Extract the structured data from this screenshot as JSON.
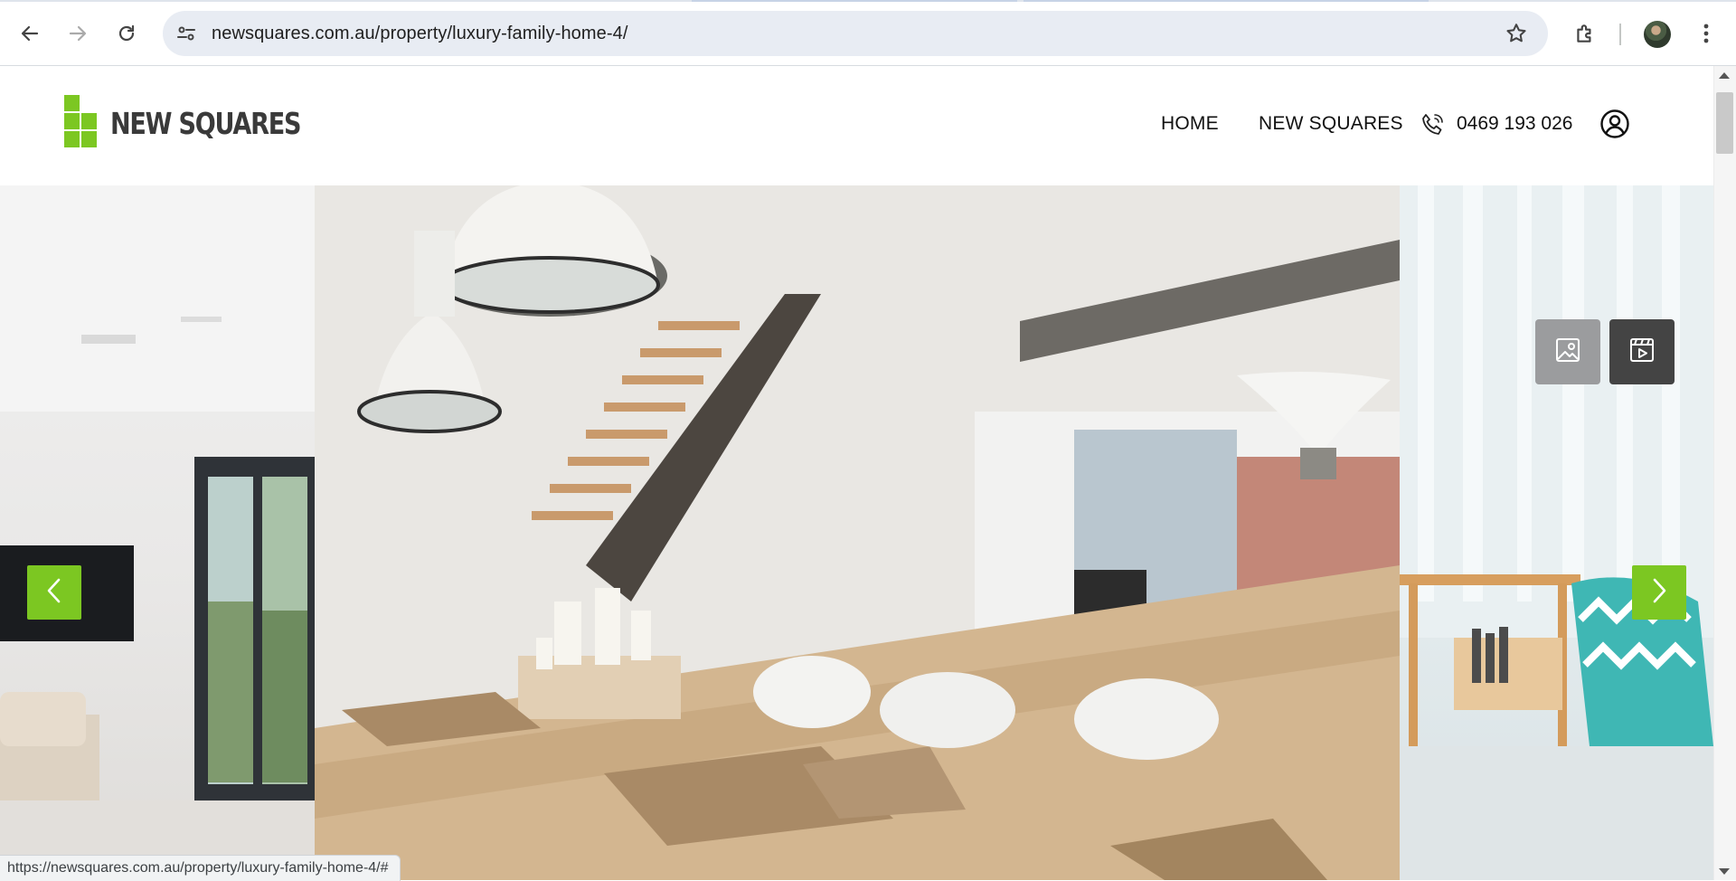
{
  "browser": {
    "url": "newsquares.com.au/property/luxury-family-home-4/",
    "status_url": "https://newsquares.com.au/property/luxury-family-home-4/#"
  },
  "site": {
    "logo_text": "NEW SQUARES",
    "nav": {
      "home": "HOME",
      "new_squares": "NEW SQUARES",
      "phone": "0469 193 026"
    }
  },
  "gallery": {
    "photo_view_icon": "image-gallery-icon",
    "video_view_icon": "video-play-icon",
    "prev_icon": "chevron-left-icon",
    "next_icon": "chevron-right-icon"
  },
  "colors": {
    "brand_green": "#7cc722",
    "logo_text": "#3a3a3a",
    "photo_button": "#9b9c9e",
    "video_button": "#444444"
  }
}
